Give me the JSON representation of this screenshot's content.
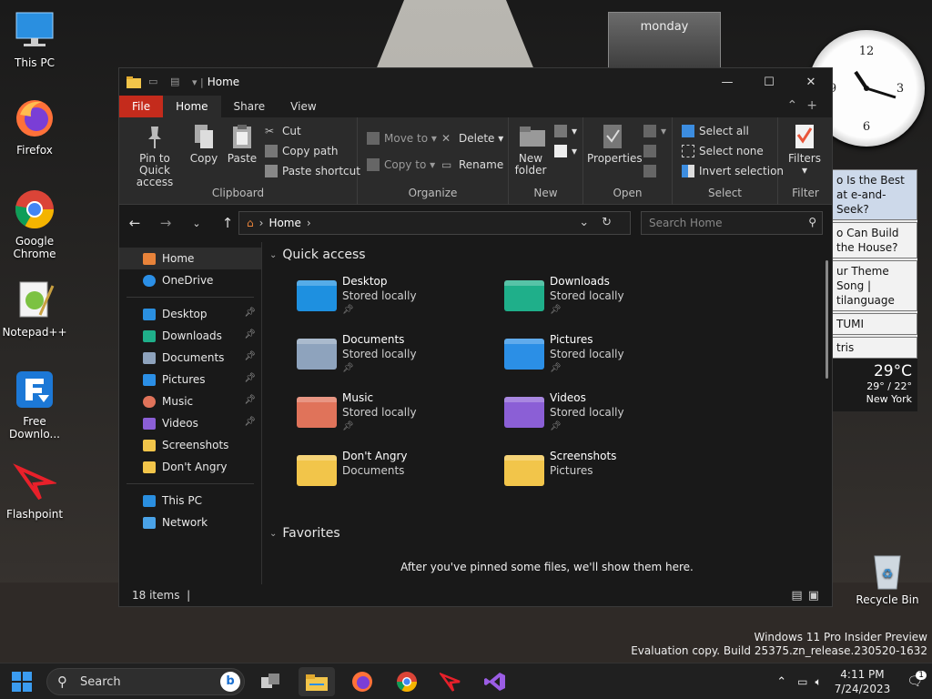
{
  "desktop": {
    "icons": [
      {
        "label": "This PC"
      },
      {
        "label": "Firefox"
      },
      {
        "label": "Google Chrome"
      },
      {
        "label": "Notepad++"
      },
      {
        "label": "Free Downlo..."
      },
      {
        "label": "Flashpoint"
      }
    ],
    "recycle_bin": "Recycle Bin",
    "watermark_line1": "Windows 11 Pro Insider Preview",
    "watermark_line2": "Evaluation copy. Build 25375.zn_release.230520-1632"
  },
  "gadgets": {
    "calendar_day": "monday",
    "news": [
      "o Is the Best at e-and-Seek?",
      "o Can Build the House?",
      "ur Theme Song | tilanguage",
      "TUMI",
      "tris"
    ],
    "weather_temp": "29°C",
    "weather_range": "29° / 22°",
    "weather_city": "New York"
  },
  "window": {
    "title": "Home",
    "tabs": [
      "File",
      "Home",
      "Share",
      "View"
    ],
    "ribbon": {
      "clipboard": {
        "label": "Clipboard",
        "pin": "Pin to Quick access",
        "copy": "Copy",
        "paste": "Paste",
        "cut": "Cut",
        "copy_path": "Copy path",
        "paste_shortcut": "Paste shortcut"
      },
      "organize": {
        "label": "Organize",
        "move_to": "Move to",
        "copy_to": "Copy to",
        "delete": "Delete",
        "rename": "Rename"
      },
      "new": {
        "label": "New",
        "new_folder": "New folder"
      },
      "open": {
        "label": "Open",
        "properties": "Properties"
      },
      "select": {
        "label": "Select",
        "select_all": "Select all",
        "select_none": "Select none",
        "invert": "Invert selection"
      },
      "filter": {
        "label": "Filter",
        "filters": "Filters"
      }
    },
    "address": {
      "location": "Home",
      "search_placeholder": "Search Home"
    },
    "sidebar": {
      "group1": [
        {
          "label": "Home"
        },
        {
          "label": "OneDrive"
        }
      ],
      "group2": [
        {
          "label": "Desktop",
          "pinned": true
        },
        {
          "label": "Downloads",
          "pinned": true
        },
        {
          "label": "Documents",
          "pinned": true
        },
        {
          "label": "Pictures",
          "pinned": true
        },
        {
          "label": "Music",
          "pinned": true
        },
        {
          "label": "Videos",
          "pinned": true
        },
        {
          "label": "Screenshots",
          "pinned": false
        },
        {
          "label": "Don't Angry",
          "pinned": false
        }
      ],
      "group3": [
        {
          "label": "This PC"
        },
        {
          "label": "Network"
        }
      ]
    },
    "quick_access": {
      "title": "Quick access",
      "items": [
        {
          "name": "Desktop",
          "sub": "Stored locally",
          "color": "#1e90e0"
        },
        {
          "name": "Downloads",
          "sub": "Stored locally",
          "color": "#1faf8a"
        },
        {
          "name": "Documents",
          "sub": "Stored locally",
          "color": "#8ea3bd"
        },
        {
          "name": "Pictures",
          "sub": "Stored locally",
          "color": "#2b8fe6"
        },
        {
          "name": "Music",
          "sub": "Stored locally",
          "color": "#e0735a"
        },
        {
          "name": "Videos",
          "sub": "Stored locally",
          "color": "#8b5fd6"
        },
        {
          "name": "Don't Angry",
          "sub": "Documents",
          "color": "#f2c54a"
        },
        {
          "name": "Screenshots",
          "sub": "Pictures",
          "color": "#f2c54a"
        }
      ]
    },
    "favorites": {
      "title": "Favorites",
      "empty": "After you've pinned some files, we'll show them here."
    },
    "status": "18 items"
  },
  "taskbar": {
    "search": "Search",
    "time": "4:11 PM",
    "date": "7/24/2023",
    "notifications": "1"
  }
}
